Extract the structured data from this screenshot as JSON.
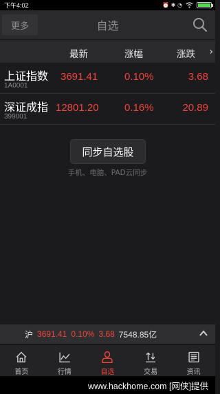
{
  "status_bar": {
    "time": "下午4:02",
    "icons_text": "⏰ ✱ ◔"
  },
  "header": {
    "more_label": "更多",
    "title": "自选"
  },
  "columns": {
    "latest": "最新",
    "change_pct": "涨幅",
    "change": "涨跌"
  },
  "stocks": [
    {
      "name": "上证指数",
      "code": "1A0001",
      "price": "3691.41",
      "pct": "0.10%",
      "chg": "3.68"
    },
    {
      "name": "深证成指",
      "code": "399001",
      "price": "12801.20",
      "pct": "0.16%",
      "chg": "20.89"
    }
  ],
  "sync": {
    "button_label": "同步自选股",
    "hint": "手机、电脑、PAD云同步"
  },
  "ticker": {
    "market": "沪",
    "price": "3691.41",
    "pct": "0.10%",
    "chg": "3.68",
    "volume": "7548.85亿"
  },
  "tabs": [
    {
      "label": "首页",
      "icon": "home-icon"
    },
    {
      "label": "行情",
      "icon": "chart-icon"
    },
    {
      "label": "自选",
      "icon": "person-icon"
    },
    {
      "label": "交易",
      "icon": "trade-icon"
    },
    {
      "label": "资讯",
      "icon": "news-icon"
    }
  ],
  "watermark": "www.hackhome.com [网侠]提供",
  "colors": {
    "up_red": "#f2453a",
    "background": "#1b1b1d",
    "bar": "#2a2a2c"
  },
  "battery_level_pct": 100
}
